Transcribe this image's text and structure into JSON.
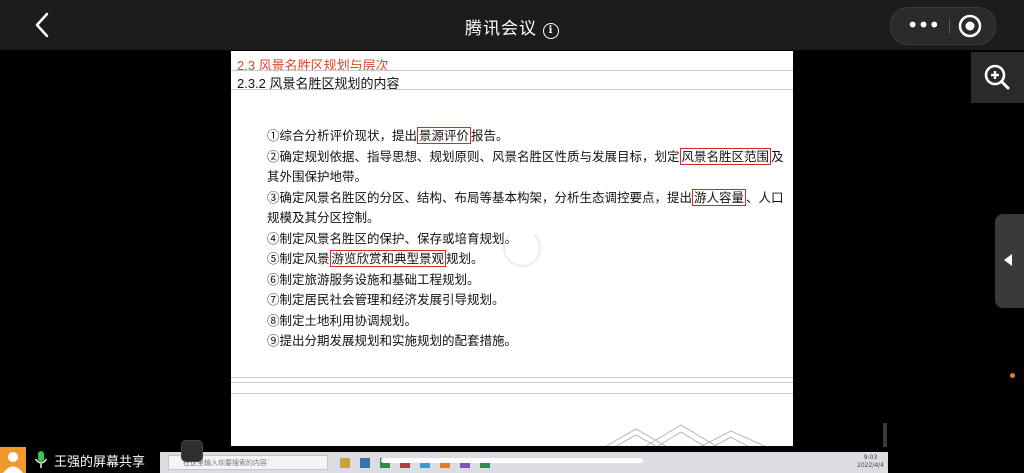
{
  "window": {
    "title": "腾讯会议",
    "info_icon": "info-icon",
    "back_icon": "chevron-left-icon",
    "more_icon": "more-dots-icon",
    "record_icon": "record-icon"
  },
  "document": {
    "heading_section": "2.3 风景名胜区规划与层次",
    "heading_subsection": "2.3.2 风景名胜区规划的内容",
    "items": [
      {
        "pre": "①综合分析评价现状，提出",
        "hl": "景源评价",
        "post": "报告。"
      },
      {
        "pre": "②确定规划依据、指导思想、规划原则、风景名胜区性质与发展目标，划定",
        "hl": "风景名胜区范围",
        "post": "及其外围保护地带。"
      },
      {
        "pre": "③确定风景名胜区的分区、结构、布局等基本构架，分析生态调控要点，提出",
        "hl": "游人容量",
        "post": "、人口规模及其分区控制。"
      },
      {
        "pre": "④制定风景名胜区的保护、保存或培育规划。",
        "hl": "",
        "post": ""
      },
      {
        "pre": "⑤制定风景",
        "hl": "游览欣赏和典型景观",
        "post": "规划。"
      },
      {
        "pre": "⑥制定旅游服务设施和基础工程规划。",
        "hl": "",
        "post": ""
      },
      {
        "pre": "⑦制定居民社会管理和经济发展引导规划。",
        "hl": "",
        "post": ""
      },
      {
        "pre": "⑧制定土地利用协调规划。",
        "hl": "",
        "post": ""
      },
      {
        "pre": "⑨提出分期发展规划和实施规划的配套措施。",
        "hl": "",
        "post": ""
      }
    ]
  },
  "taskbar": {
    "search_placeholder": "在这里输入你要搜索的内容",
    "time": "9:03",
    "date": "2022/4/4"
  },
  "share": {
    "label": "王强的屏幕共享"
  },
  "controls": {
    "zoom_icon": "zoom-in-icon",
    "collapse_icon": "triangle-left-icon"
  },
  "colors": {
    "heading_red": "#d9482b",
    "highlight_box": "#d22a2a",
    "topbar_bg": "#1c1c1e",
    "avatar_orange": "#f09a2e"
  }
}
